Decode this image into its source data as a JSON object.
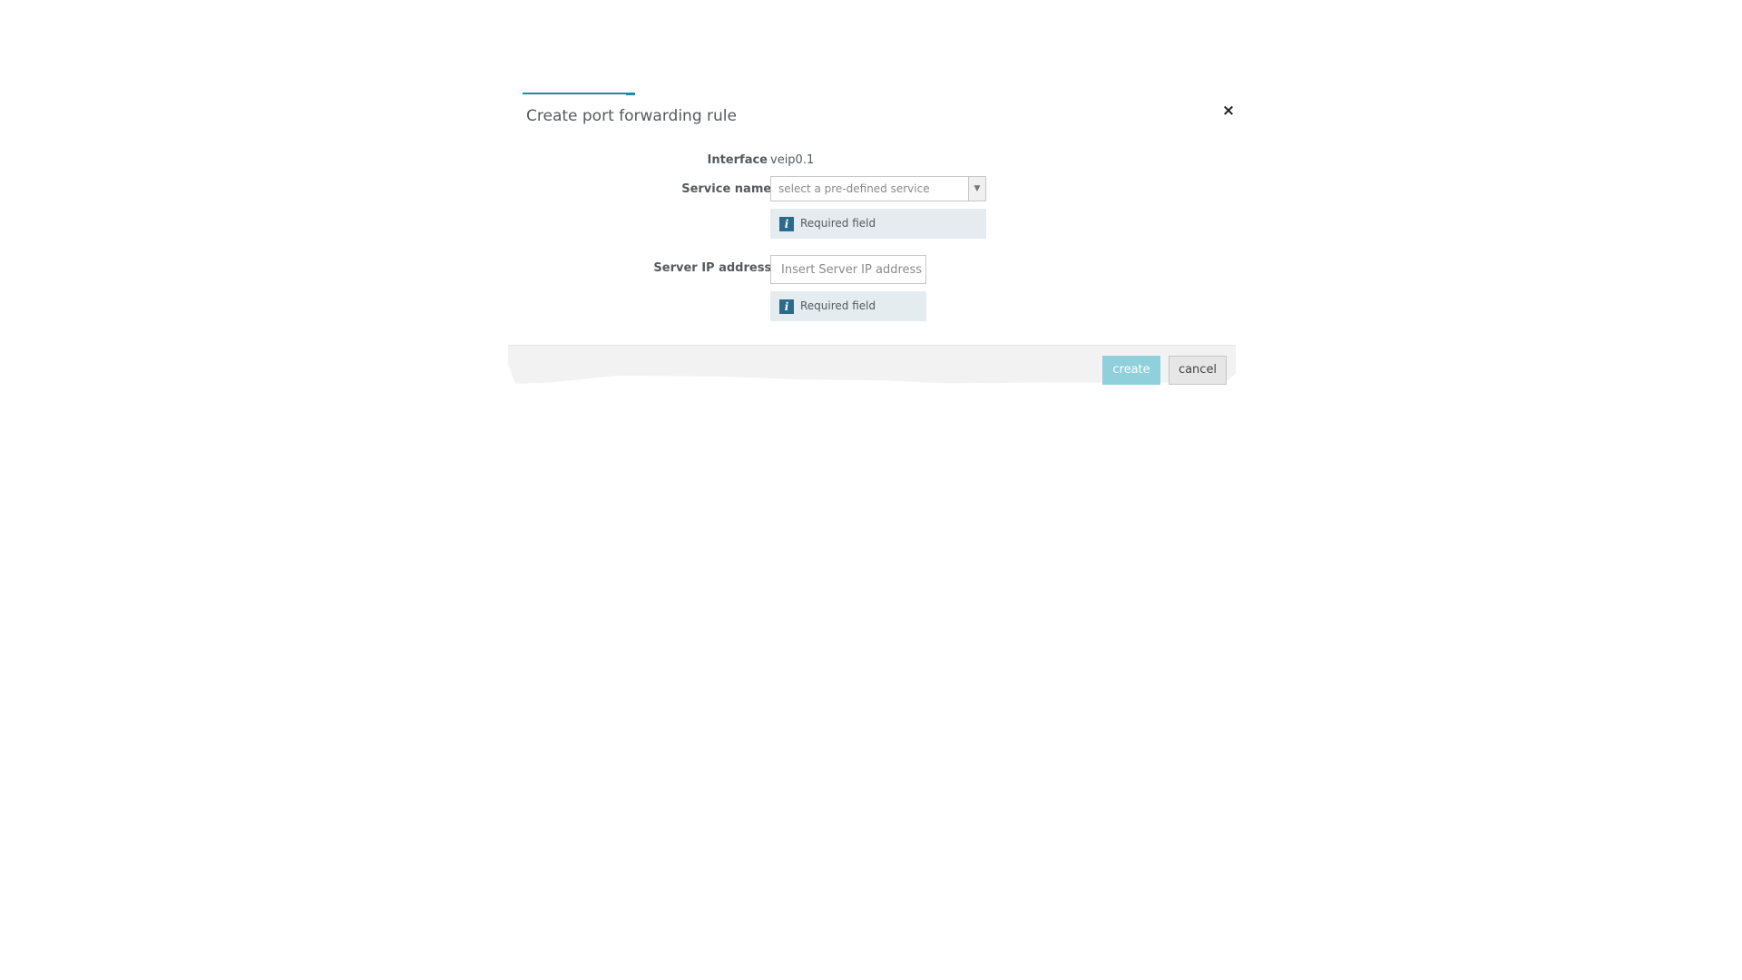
{
  "dialog": {
    "title": "Create port forwarding rule",
    "close_glyph": "×",
    "close_icon": "close-icon"
  },
  "form": {
    "interface": {
      "label": "Interface",
      "value": "veip0.1"
    },
    "service_name": {
      "label": "Service name",
      "required_marker": "*",
      "placeholder": "select a pre-defined service",
      "dropdown_icon": "chevron-down-icon",
      "dropdown_glyph": "▼",
      "hint": "Required field",
      "hint_icon": "info-icon",
      "hint_glyph": "i"
    },
    "server_ip": {
      "label": "Server IP address",
      "required_marker": "*",
      "placeholder": "Insert Server IP address",
      "value": "",
      "hint": "Required field",
      "hint_icon": "info-icon",
      "hint_glyph": "i"
    }
  },
  "footer": {
    "create_label": "create",
    "cancel_label": "cancel"
  },
  "colors": {
    "accent": "#1a8ea3",
    "create_button": "#8fd0dc",
    "hint_background": "#e4ecf0",
    "info_icon": "#2b6a8a",
    "required_marker": "#d9534f"
  }
}
